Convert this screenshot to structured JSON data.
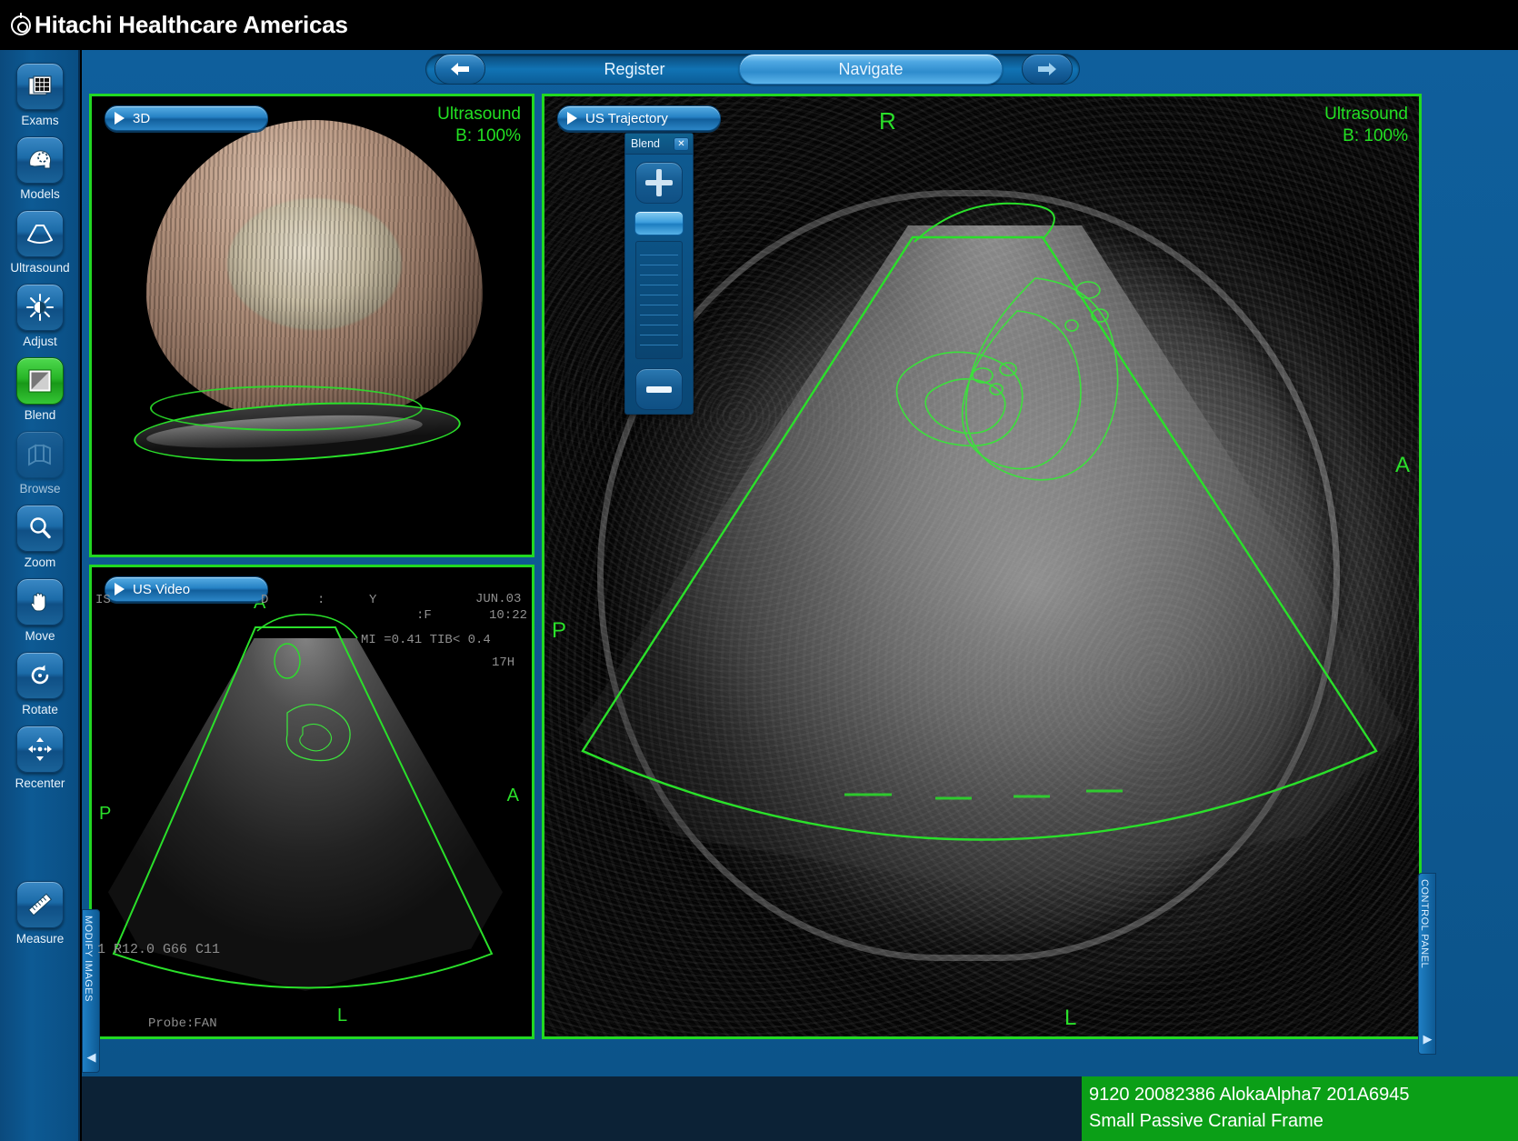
{
  "app": {
    "title": "Hitachi Healthcare Americas",
    "logo_icon": "target-logo-icon"
  },
  "nav": {
    "back_label": "◀",
    "forward_label": "▶",
    "steps": [
      {
        "label": "Register",
        "active": false
      },
      {
        "label": "Navigate",
        "active": true
      }
    ]
  },
  "sidebar": {
    "items": [
      {
        "label": "Exams",
        "icon": "exams-grid-icon",
        "state": "normal"
      },
      {
        "label": "Models",
        "icon": "head-model-icon",
        "state": "normal"
      },
      {
        "label": "Ultrasound",
        "icon": "ultrasound-fan-icon",
        "state": "normal"
      },
      {
        "label": "Adjust",
        "icon": "brightness-icon",
        "state": "normal"
      },
      {
        "label": "Blend",
        "icon": "blend-square-icon",
        "state": "active"
      },
      {
        "label": "Browse",
        "icon": "stack-layers-icon",
        "state": "disabled"
      },
      {
        "label": "Zoom",
        "icon": "magnifier-icon",
        "state": "normal"
      },
      {
        "label": "Move",
        "icon": "hand-icon",
        "state": "normal"
      },
      {
        "label": "Rotate",
        "icon": "rotate-arrow-icon",
        "state": "normal"
      },
      {
        "label": "Recenter",
        "icon": "recenter-arrows-icon",
        "state": "normal"
      },
      {
        "label": "Measure",
        "icon": "ruler-icon",
        "state": "normal"
      }
    ]
  },
  "side_tabs": {
    "left": {
      "label": "MODIFY IMAGES",
      "arrow": "◀"
    },
    "right": {
      "label": "CONTROL PANEL",
      "arrow": "▶"
    }
  },
  "panels": {
    "three_d": {
      "title": "3D",
      "play_icon": "play-triangle-icon",
      "mode_line1": "Ultrasound",
      "mode_line2": "B: 100%"
    },
    "us_video": {
      "title": "US Video",
      "play_icon": "play-triangle-icon",
      "orient_top": "A",
      "orient_left": "P",
      "orient_right": "A",
      "orient_bottom": "L",
      "overlay": {
        "line_left": "IS",
        "line_mid": "D",
        "colon": ":",
        "y_mark": "Y",
        "f_mark": ":F",
        "date": "JUN.03",
        "time": "10:22",
        "mi": "MI =0.41 TIB< 0.4",
        "depth_label": "17H",
        "params": "1 R12.0 G66 C11",
        "probe": "Probe:FAN"
      }
    },
    "us_trajectory": {
      "title": "US Trajectory",
      "play_icon": "play-triangle-icon",
      "mode_line1": "Ultrasound",
      "mode_line2": "B: 100%",
      "orient_top": "R",
      "orient_left": "P",
      "orient_right": "A",
      "orient_bottom": "L"
    }
  },
  "blend_widget": {
    "title": "Blend",
    "close_label": "✕",
    "increase_icon": "plus-icon",
    "decrease_icon": "minus-icon",
    "thumb_name": "blend-slider-thumb"
  },
  "status": {
    "line1": "9120 20082386 AlokaAlpha7 201A6945",
    "line2": "Small Passive Cranial Frame"
  },
  "colors": {
    "accent_green": "#22d822",
    "status_green": "#0b9f17",
    "panel_blue": "#0f5f9c",
    "active_tool_green": "#27b527"
  }
}
